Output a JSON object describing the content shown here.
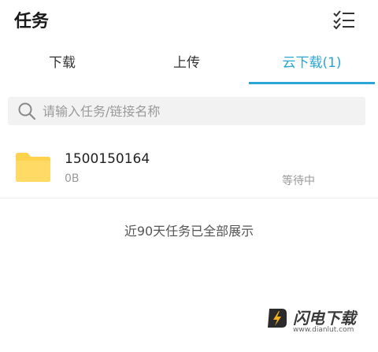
{
  "header": {
    "title": "任务",
    "menu_icon": "checklist-icon"
  },
  "tabs": [
    {
      "label": "下载",
      "active": false
    },
    {
      "label": "上传",
      "active": false
    },
    {
      "label": "云下载(1)",
      "active": true
    }
  ],
  "colors": {
    "accent": "#2aa5d6",
    "folder": "#ffd24d"
  },
  "search": {
    "placeholder": "请输入任务/链接名称",
    "value": "",
    "icon": "search-icon"
  },
  "tasks": [
    {
      "name": "1500150164",
      "size": "0B",
      "status": "等待中",
      "icon": "folder-icon"
    }
  ],
  "footer": {
    "note": "近90天任务已全部展示"
  },
  "watermark": {
    "text": "闪电下载",
    "url": "www.dianlut.com"
  }
}
